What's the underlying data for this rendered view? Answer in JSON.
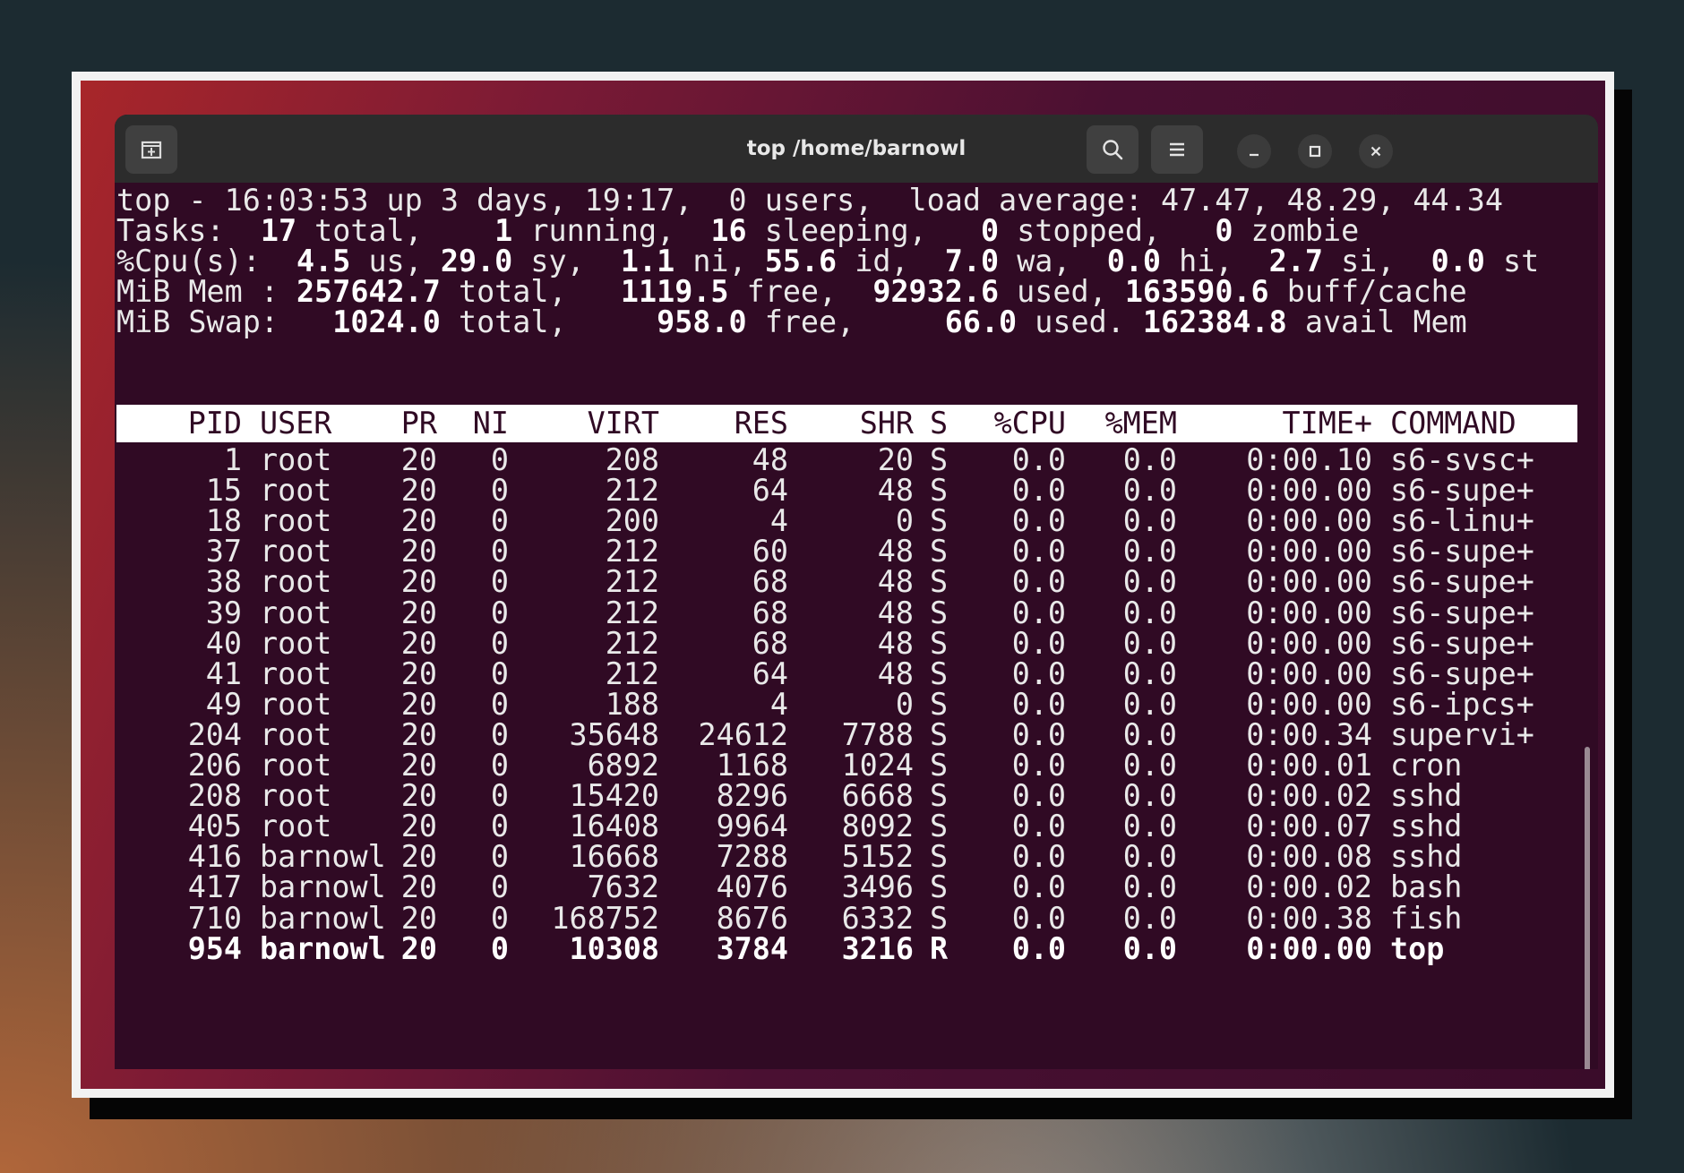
{
  "window": {
    "title": "top /home/barnowl",
    "buttons": {
      "new_tab_icon": "new-tab-icon",
      "search_icon": "search-icon",
      "menu_icon": "hamburger-menu-icon",
      "minimize_icon": "minimize-icon",
      "maximize_icon": "maximize-icon",
      "close_icon": "close-icon"
    }
  },
  "summary": {
    "line1": "top - 16:03:53 up 3 days, 19:17,  0 users,  load average: 47.47, 48.29, 44.34",
    "tasks": {
      "label": "Tasks: ",
      "total": " 17",
      "total_label": " total,   ",
      "running": " 1",
      "running_label": " running,  ",
      "sleeping": "16",
      "sleeping_label": " sleeping,   ",
      "stopped": "0",
      "stopped_label": " stopped,   ",
      "zombie": "0",
      "zombie_label": " zombie"
    },
    "cpu": {
      "label": "%Cpu(s):  ",
      "us": "4.5",
      "us_label": " us, ",
      "sy": "29.0",
      "sy_label": " sy,  ",
      "ni": "1.1",
      "ni_label": " ni, ",
      "id": "55.6",
      "id_label": " id,  ",
      "wa": "7.0",
      "wa_label": " wa,  ",
      "hi": "0.0",
      "hi_label": " hi,  ",
      "si": "2.7",
      "si_label": " si,  ",
      "st": "0.0",
      "st_label": " st"
    },
    "mem": {
      "label": "MiB Mem : ",
      "total": "257642.7",
      "total_label": " total,   ",
      "free": "1119.5",
      "free_label": " free,  ",
      "used": "92932.6",
      "used_label": " used, ",
      "buff": "163590.6",
      "buff_label": " buff/cache"
    },
    "swap": {
      "label": "MiB Swap:   ",
      "total": "1024.0",
      "total_label": " total,     ",
      "free": "958.0",
      "free_label": " free,     ",
      "used": "66.0",
      "used_label": " used. ",
      "avail": "162384.8",
      "avail_label": " avail Mem"
    }
  },
  "columns": [
    "PID",
    "USER",
    "PR",
    "NI",
    "VIRT",
    "RES",
    "SHR",
    "S",
    "%CPU",
    "%MEM",
    "TIME+",
    "COMMAND"
  ],
  "processes": [
    [
      "1",
      "root",
      "20",
      "0",
      "208",
      "48",
      "20",
      "S",
      "0.0",
      "0.0",
      "0:00.10",
      "s6-svsc+"
    ],
    [
      "15",
      "root",
      "20",
      "0",
      "212",
      "64",
      "48",
      "S",
      "0.0",
      "0.0",
      "0:00.00",
      "s6-supe+"
    ],
    [
      "18",
      "root",
      "20",
      "0",
      "200",
      "4",
      "0",
      "S",
      "0.0",
      "0.0",
      "0:00.00",
      "s6-linu+"
    ],
    [
      "37",
      "root",
      "20",
      "0",
      "212",
      "60",
      "48",
      "S",
      "0.0",
      "0.0",
      "0:00.00",
      "s6-supe+"
    ],
    [
      "38",
      "root",
      "20",
      "0",
      "212",
      "68",
      "48",
      "S",
      "0.0",
      "0.0",
      "0:00.00",
      "s6-supe+"
    ],
    [
      "39",
      "root",
      "20",
      "0",
      "212",
      "68",
      "48",
      "S",
      "0.0",
      "0.0",
      "0:00.00",
      "s6-supe+"
    ],
    [
      "40",
      "root",
      "20",
      "0",
      "212",
      "68",
      "48",
      "S",
      "0.0",
      "0.0",
      "0:00.00",
      "s6-supe+"
    ],
    [
      "41",
      "root",
      "20",
      "0",
      "212",
      "64",
      "48",
      "S",
      "0.0",
      "0.0",
      "0:00.00",
      "s6-supe+"
    ],
    [
      "49",
      "root",
      "20",
      "0",
      "188",
      "4",
      "0",
      "S",
      "0.0",
      "0.0",
      "0:00.00",
      "s6-ipcs+"
    ],
    [
      "204",
      "root",
      "20",
      "0",
      "35648",
      "24612",
      "7788",
      "S",
      "0.0",
      "0.0",
      "0:00.34",
      "supervi+"
    ],
    [
      "206",
      "root",
      "20",
      "0",
      "6892",
      "1168",
      "1024",
      "S",
      "0.0",
      "0.0",
      "0:00.01",
      "cron"
    ],
    [
      "208",
      "root",
      "20",
      "0",
      "15420",
      "8296",
      "6668",
      "S",
      "0.0",
      "0.0",
      "0:00.02",
      "sshd"
    ],
    [
      "405",
      "root",
      "20",
      "0",
      "16408",
      "9964",
      "8092",
      "S",
      "0.0",
      "0.0",
      "0:00.07",
      "sshd"
    ],
    [
      "416",
      "barnowl",
      "20",
      "0",
      "16668",
      "7288",
      "5152",
      "S",
      "0.0",
      "0.0",
      "0:00.08",
      "sshd"
    ],
    [
      "417",
      "barnowl",
      "20",
      "0",
      "7632",
      "4076",
      "3496",
      "S",
      "0.0",
      "0.0",
      "0:00.02",
      "bash"
    ],
    [
      "710",
      "barnowl",
      "20",
      "0",
      "168752",
      "8676",
      "6332",
      "S",
      "0.0",
      "0.0",
      "0:00.38",
      "fish"
    ],
    [
      "954",
      "barnowl",
      "20",
      "0",
      "10308",
      "3784",
      "3216",
      "R",
      "0.0",
      "0.0",
      "0:00.00",
      "top"
    ]
  ],
  "highlighted_row": 16
}
